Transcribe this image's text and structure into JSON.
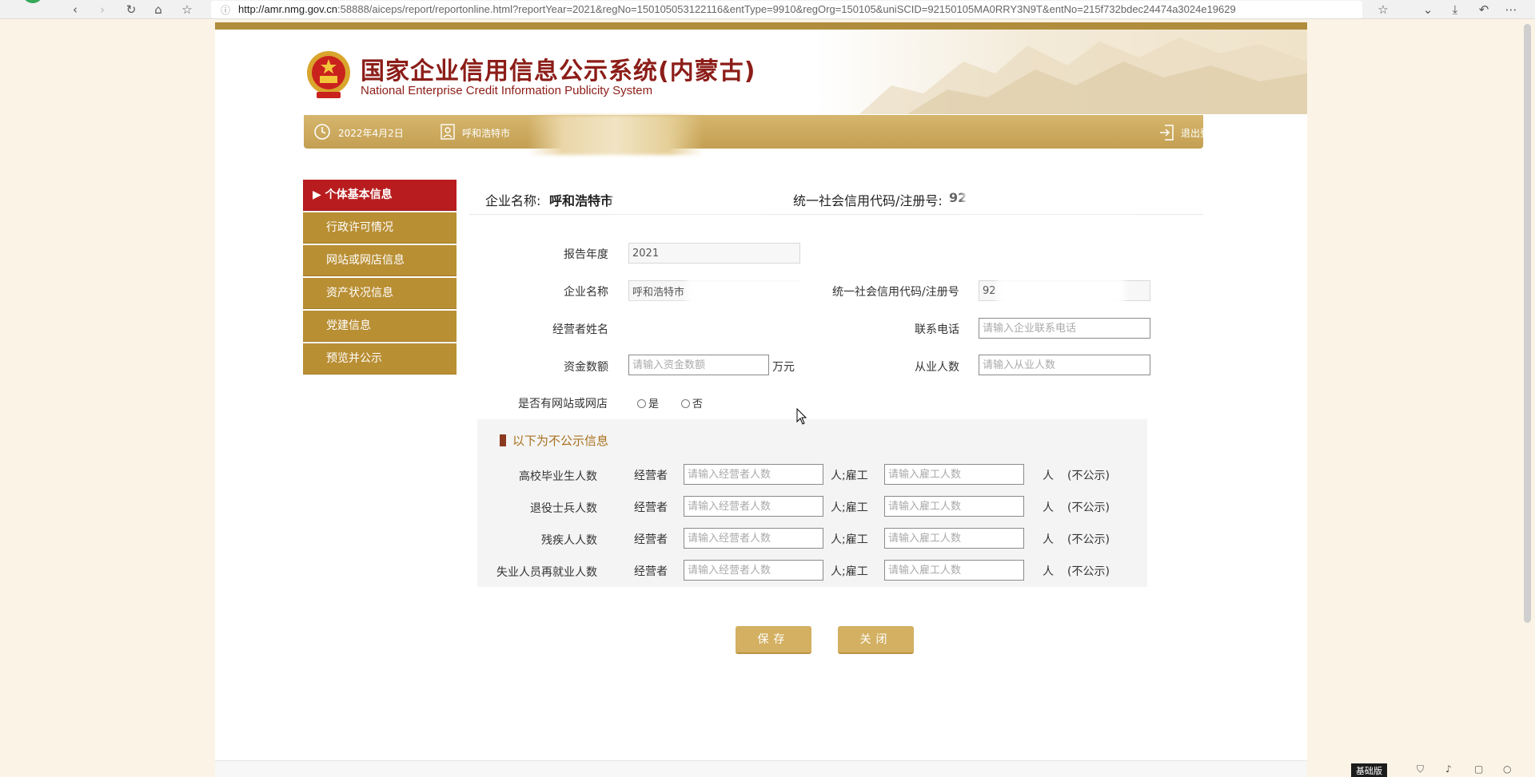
{
  "browser": {
    "back_icon": "‹",
    "forward_icon": "›",
    "reload_icon": "↻",
    "home_icon": "⌂",
    "bookmark_icon": "☆",
    "info_icon": "ⓘ",
    "url_host": "http://amr.nmg.gov.cn",
    "url_rest": ":58888/aiceps/report/reportonline.html?reportYear=2021&regNo=150105053122116&entType=9910&regOrg=150105&uniSCID=92150105MA0RRY3N9T&entNo=215f732bdec24474a3024e19629",
    "star_icon": "☆",
    "chevron_icon": "⌄",
    "download_icon": "⤓",
    "undo_icon": "↶",
    "more_icon": "⋯"
  },
  "header": {
    "title": "国家企业信用信息公示系统(内蒙古)",
    "subtitle": "National Enterprise Credit Information Publicity System"
  },
  "nav": {
    "date": "2022年4月2日",
    "user": "呼和浩特市",
    "logout": "退出登录"
  },
  "sidebar": {
    "items": [
      {
        "label": "▶ 个体基本信息",
        "active": true
      },
      {
        "label": "行政许可情况",
        "active": false
      },
      {
        "label": "网站或网店信息",
        "active": false
      },
      {
        "label": "资产状况信息",
        "active": false
      },
      {
        "label": "党建信息",
        "active": false
      },
      {
        "label": "预览并公示",
        "active": false
      }
    ]
  },
  "content_head": {
    "name_label": "企业名称:",
    "name_value": "呼和浩特市",
    "code_label": "统一社会信用代码/注册号:",
    "code_value": "92"
  },
  "form": {
    "year_label": "报告年度",
    "year_value": "2021",
    "company_label": "企业名称",
    "company_value": "呼和浩特市",
    "code_label": "统一社会信用代码/注册号",
    "code_value": "92",
    "operator_label": "经营者姓名",
    "operator_value": "",
    "phone_label": "联系电话",
    "phone_placeholder": "请输入企业联系电话",
    "capital_label": "资金数额",
    "capital_placeholder": "请输入资金数额",
    "capital_unit": "万元",
    "employees_label": "从业人数",
    "employees_placeholder": "请输入从业人数",
    "website_label": "是否有网站或网店",
    "website_yes": "是",
    "website_no": "否"
  },
  "private": {
    "title": "以下为不公示信息",
    "operator_word": "经营者",
    "operator_placeholder": "请输入经营者人数",
    "person_unit_sep": "人;雇工",
    "employee_placeholder": "请输入雇工人数",
    "person_unit": "人",
    "not_public": "(不公示)",
    "rows": [
      {
        "label": "高校毕业生人数"
      },
      {
        "label": "退役士兵人数"
      },
      {
        "label": "残疾人人数"
      },
      {
        "label": "失业人员再就业人数"
      }
    ]
  },
  "buttons": {
    "save": "保存",
    "close": "关闭"
  },
  "status": {
    "version": "基础版"
  },
  "colors": {
    "gold": "#b98f34",
    "red_active": "#b81c1e",
    "title_red": "#8c1d18",
    "button_gold": "#d3b062",
    "page_bg": "#fbf3e6"
  }
}
